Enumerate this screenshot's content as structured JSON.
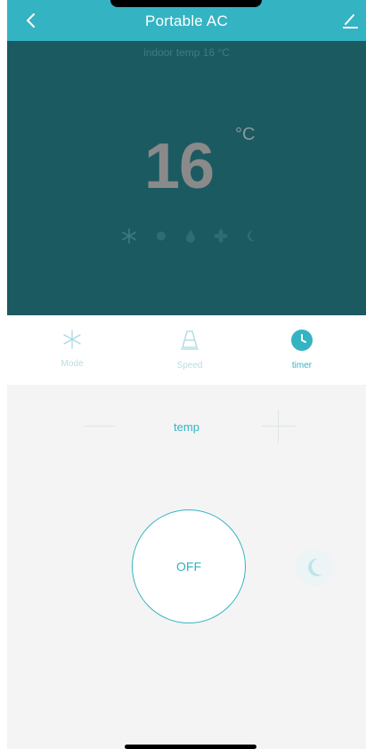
{
  "header": {
    "title": "Portable AC",
    "back_icon": "chevron-left-icon",
    "edit_icon": "edit-icon"
  },
  "display": {
    "indoor_temp": "indoor temp 16 °C",
    "set_temp": "16",
    "unit": "°C",
    "mode_icons": [
      "snowflake-icon",
      "dot-icon",
      "drop-icon",
      "fan-icon",
      "moon-icon"
    ]
  },
  "tabs": [
    {
      "label": "Mode",
      "icon": "snowflake-icon",
      "active": false
    },
    {
      "label": "Speed",
      "icon": "cone-icon",
      "active": false
    },
    {
      "label": "timer",
      "icon": "clock-icon",
      "active": true
    }
  ],
  "control": {
    "temp_label": "temp",
    "power_label": "OFF",
    "sleep_icon": "moon-icon"
  },
  "colors": {
    "accent": "#34b3c3",
    "display_bg": "#1c5a62",
    "control_bg": "#f4f4f4"
  }
}
